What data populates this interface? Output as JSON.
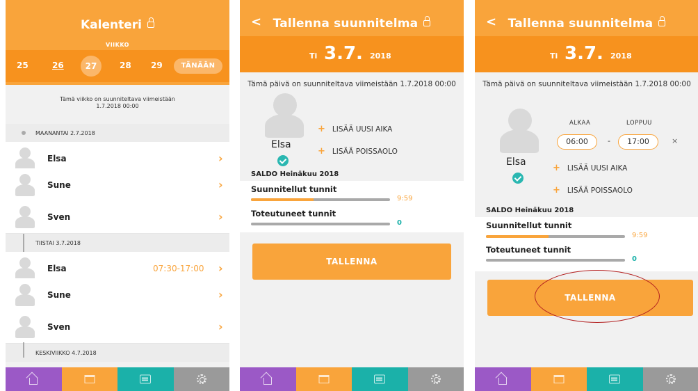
{
  "colors": {
    "orange": "#f9a43b",
    "dark_orange": "#f7921e",
    "teal": "#1bb1a9",
    "purple": "#9b59c6",
    "gray": "#9a9a9a"
  },
  "screen1": {
    "title": "Kalenteri",
    "week_label": "VIIKKO",
    "week_days": [
      "25",
      "26",
      "27",
      "28",
      "29"
    ],
    "today_button": "TÄNÄÄN",
    "notice": "Tämä viikko on suunniteltava viimeistään 1.7.2018 00:00",
    "days": [
      {
        "label": "MAANANTAI 2.7.2018",
        "employees": [
          {
            "name": "Elsa",
            "time": ""
          },
          {
            "name": "Sune",
            "time": ""
          },
          {
            "name": "Sven",
            "time": ""
          }
        ]
      },
      {
        "label": "TIISTAI 3.7.2018",
        "employees": [
          {
            "name": "Elsa",
            "time": "07:30-17:00"
          },
          {
            "name": "Sune",
            "time": ""
          },
          {
            "name": "Sven",
            "time": ""
          }
        ]
      },
      {
        "label": "KESKIVIIKKO 4.7.2018",
        "employees": []
      }
    ]
  },
  "screen2": {
    "title": "Tallenna suunnitelma",
    "weekday": "Ti",
    "date": "3.7.",
    "year": "2018",
    "notice": "Tämä päivä on suunniteltava viimeistään 1.7.2018 00:00",
    "employee": "Elsa",
    "add_time": "LISÄÄ UUSI AIKA",
    "add_absence": "LISÄÄ POISSAOLO",
    "saldo": "SALDO Heinäkuu 2018",
    "planned_label": "Suunnitellut tunnit",
    "planned_value": "9:59",
    "planned_fraction": 0.45,
    "actual_label": "Toteutuneet tunnit",
    "actual_value": "0",
    "save": "TALLENNA"
  },
  "screen3": {
    "title": "Tallenna suunnitelma",
    "weekday": "Ti",
    "date": "3.7.",
    "year": "2018",
    "notice": "Tämä päivä on suunniteltava viimeistään 1.7.2018 00:00",
    "employee": "Elsa",
    "start_label": "ALKAA",
    "end_label": "LOPPUU",
    "start_time": "06:00",
    "separator": "-",
    "end_time": "17:00",
    "remove": "×",
    "add_time": "LISÄÄ UUSI AIKA",
    "add_absence": "LISÄÄ POISSAOLO",
    "saldo": "SALDO Heinäkuu 2018",
    "planned_label": "Suunnitellut tunnit",
    "planned_value": "9:59",
    "planned_fraction": 0.45,
    "actual_label": "Toteutuneet tunnit",
    "actual_value": "0",
    "save": "TALLENNA"
  },
  "nav_icons": [
    "home-icon",
    "calendar-icon",
    "message-icon",
    "gear-icon"
  ]
}
